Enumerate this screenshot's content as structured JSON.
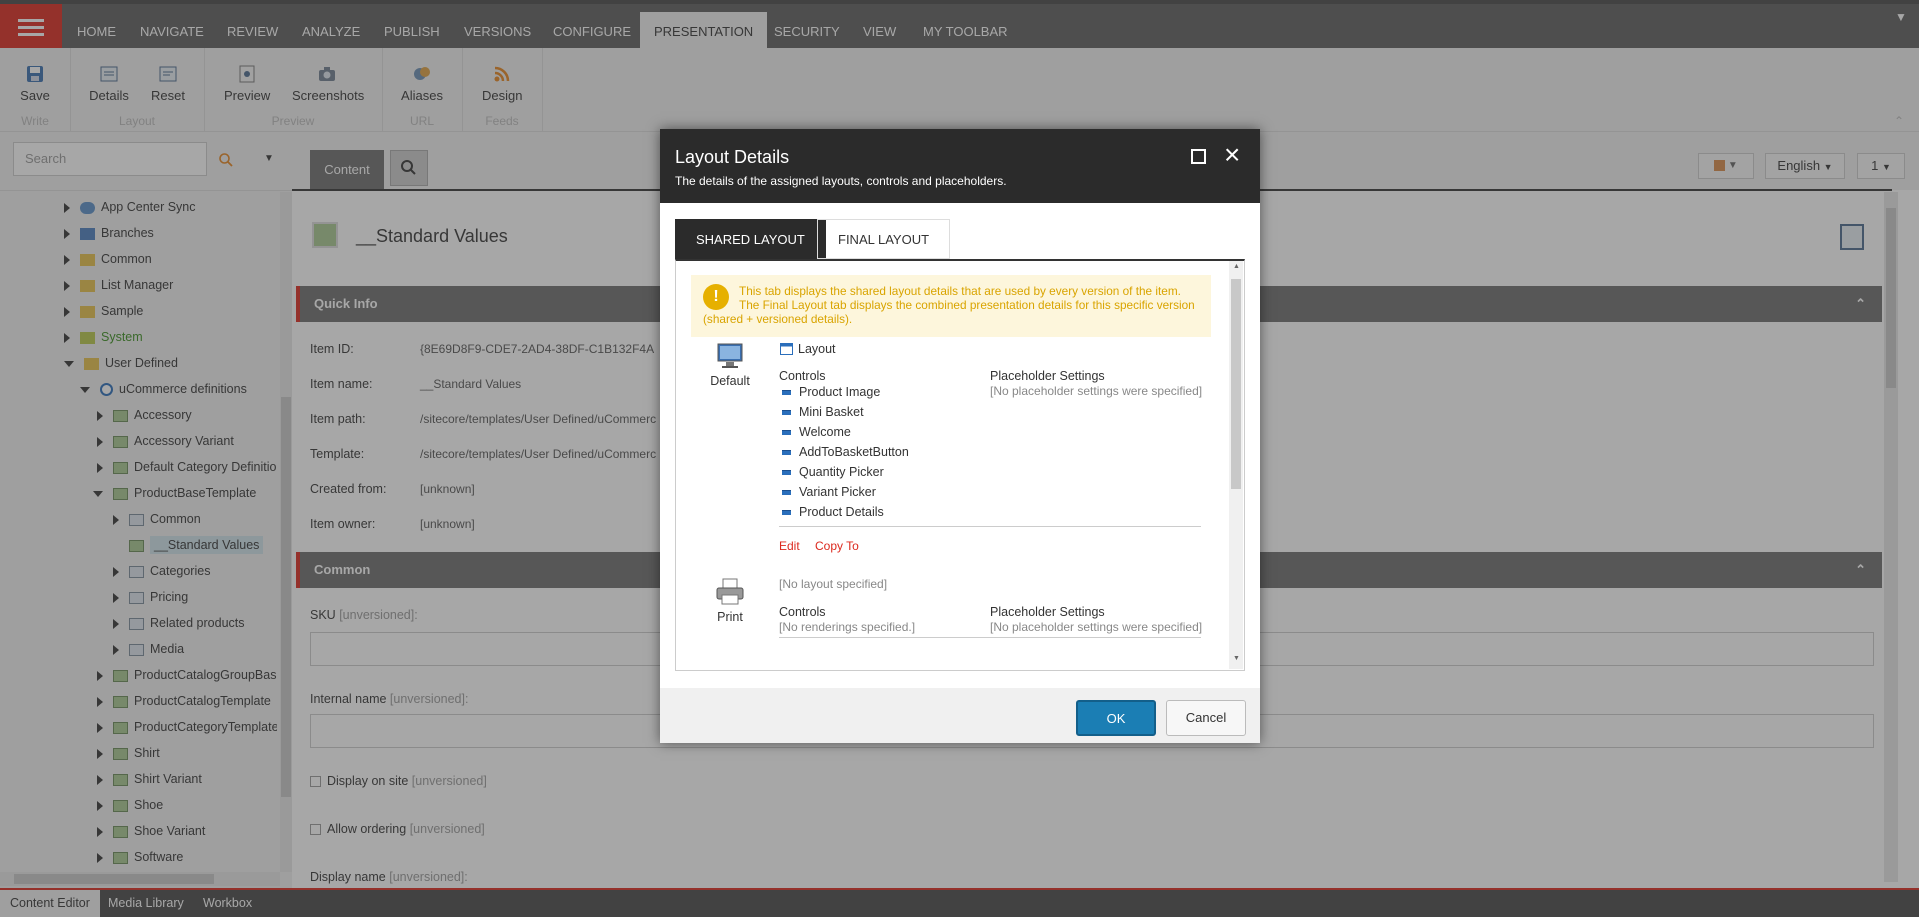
{
  "ribbon_tabs": [
    "HOME",
    "NAVIGATE",
    "REVIEW",
    "ANALYZE",
    "PUBLISH",
    "VERSIONS",
    "CONFIGURE",
    "PRESENTATION",
    "SECURITY",
    "VIEW",
    "MY TOOLBAR"
  ],
  "ribbon": {
    "save": "Save",
    "details": "Details",
    "reset": "Reset",
    "preview": "Preview",
    "screenshots": "Screenshots",
    "aliases": "Aliases",
    "design": "Design",
    "groups": {
      "write": "Write",
      "layout": "Layout",
      "preview": "Preview",
      "url": "URL",
      "feeds": "Feeds"
    }
  },
  "search": {
    "placeholder": "Search"
  },
  "tree": {
    "items": [
      {
        "label": "App Center Sync"
      },
      {
        "label": "Branches"
      },
      {
        "label": "Common"
      },
      {
        "label": "List Manager"
      },
      {
        "label": "Sample"
      },
      {
        "label": "System"
      },
      {
        "label": "User Defined"
      },
      {
        "label": "uCommerce definitions"
      },
      {
        "label": "Accessory"
      },
      {
        "label": "Accessory Variant"
      },
      {
        "label": "Default Category Definition"
      },
      {
        "label": "ProductBaseTemplate"
      },
      {
        "label": "Common"
      },
      {
        "label": "__Standard Values"
      },
      {
        "label": "Categories"
      },
      {
        "label": "Pricing"
      },
      {
        "label": "Related products"
      },
      {
        "label": "Media"
      },
      {
        "label": "ProductCatalogGroupBase"
      },
      {
        "label": "ProductCatalogTemplate"
      },
      {
        "label": "ProductCategoryTemplate"
      },
      {
        "label": "Shirt"
      },
      {
        "label": "Shirt Variant"
      },
      {
        "label": "Shoe"
      },
      {
        "label": "Shoe Variant"
      },
      {
        "label": "Software"
      }
    ]
  },
  "content": {
    "tab": "Content",
    "language": "English",
    "version": "1",
    "title": "__Standard Values",
    "quick_info": "Quick Info",
    "common": "Common",
    "fields": {
      "item_id_label": "Item ID:",
      "item_id": "{8E69D8F9-CDE7-2AD4-38DF-C1B132F4A",
      "item_name_label": "Item name:",
      "item_name": "__Standard Values",
      "item_path_label": "Item path:",
      "item_path": "/sitecore/templates/User Defined/uCommerc",
      "template_label": "Template:",
      "template": "/sitecore/templates/User Defined/uCommerc",
      "created_from_label": "Created from:",
      "created_from": "[unknown]",
      "item_owner_label": "Item owner:",
      "item_owner": "[unknown]"
    },
    "sku": "SKU",
    "internal_name": "Internal name",
    "display_on_site": "Display on site",
    "allow_ordering": "Allow ordering",
    "display_name": "Display name",
    "unversioned": "[unversioned]:",
    "unversioned_nc": "[unversioned]"
  },
  "bottom_tabs": [
    "Content Editor",
    "Media Library",
    "Workbox"
  ],
  "dialog": {
    "title": "Layout Details",
    "subtitle": "The details of the assigned layouts, controls and placeholders.",
    "tabs": [
      "SHARED LAYOUT",
      "FINAL LAYOUT"
    ],
    "notice": "This tab displays the shared layout details that are used by every version of the item. The Final Layout tab displays the combined presentation details for this specific version (shared + versioned details).",
    "default_device": "Default",
    "layout": "Layout",
    "controls_label": "Controls",
    "placeholder_label": "Placeholder Settings",
    "no_placeholder": "[No placeholder settings were specified]",
    "controls": [
      "Product Image",
      "Mini Basket",
      "Welcome",
      "AddToBasketButton",
      "Quantity Picker",
      "Variant Picker",
      "Product Details"
    ],
    "edit": "Edit",
    "copy_to": "Copy To",
    "print_device": "Print",
    "no_layout": "[No layout specified]",
    "no_renderings": "[No renderings specified.]",
    "ok": "OK",
    "cancel": "Cancel"
  },
  "colors": {
    "accent": "#dc291e",
    "header_dark": "#2b2b2b",
    "ok_button": "#1b7eb4",
    "system_green": "#3a8f1e",
    "notice": "#d9a400"
  }
}
